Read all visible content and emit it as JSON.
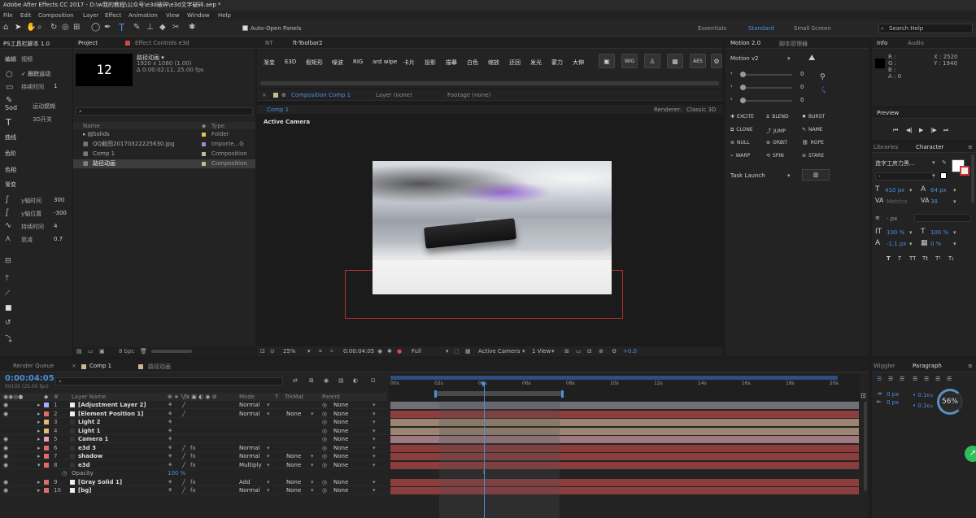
{
  "title_bar": {
    "title": "Adobe After Effects CC 2017 - D:\\w我的教程\\公众号\\e3d破碎\\e3d文字破碎.aep *"
  },
  "menu": [
    "File",
    "Edit",
    "Composition",
    "Layer",
    "Effect",
    "Animation",
    "View",
    "Window",
    "Help"
  ],
  "toolbar": {
    "auto_open_panels": "Auto-Open Panels",
    "workspaces": [
      "Essentials",
      "Standard",
      "Small Screen"
    ],
    "active_workspace": "Standard",
    "search_help": "Search Help"
  },
  "ps_panel": {
    "title": "PS工具栏脚本 1.0",
    "tabs": [
      "编辑",
      "视频"
    ],
    "auto_motion": "运动缓动",
    "auto_motion_on": "跟踪运动",
    "duration_label": "持续时间",
    "duration_value": "1",
    "motion_text": "运动模糊",
    "d3_text": "3D开关",
    "sections": [
      "曲线",
      "色阶",
      "色相",
      "渐变"
    ],
    "y_time_label": "y轴时间",
    "y_time_value": "300",
    "y_pos_label": "y轴位置",
    "y_pos_value": "-300",
    "dur_label": "持续时间",
    "dur_value": "4",
    "ease_label": "衰减",
    "ease_value": "0.7"
  },
  "project": {
    "tabs": [
      "Project",
      "Effect Controls e3d"
    ],
    "thumb_text": "12",
    "comp_name": "路径动画 ▾",
    "comp_res": "1920 x 1080 (1.00)",
    "comp_dur": "Δ 0:00:02:11, 25.00 fps",
    "cols": [
      "Name",
      "Type"
    ],
    "items": [
      {
        "name": "Solids",
        "type": "Folder",
        "color": "#d9c74a"
      },
      {
        "name": "QQ截图20170322225630.jpg",
        "type": "Importe...G",
        "color": "#9b8fd0"
      },
      {
        "name": "Comp 1",
        "type": "Composition",
        "color": "#c9b98f"
      },
      {
        "name": "路径动画",
        "type": "Composition",
        "color": "#c9b98f"
      }
    ],
    "bpc": "8 bpc"
  },
  "ft_toolbar": {
    "tabs": [
      "NT",
      "ft-Toolbar2"
    ],
    "buttons": [
      "渐变",
      "E3D",
      "假矩形",
      "噪波",
      "RIG",
      "ard wipe",
      "卡片",
      "投影",
      "描摹",
      "白色",
      "缩放",
      "还回",
      "发光",
      "蒙力",
      "大伸"
    ],
    "icon_buttons": [
      "WIG",
      "AES"
    ]
  },
  "viewer": {
    "tabs": [
      "Composition Comp 1",
      "Layer (none)",
      "Footage (none)"
    ],
    "comp_tab": "Comp 1",
    "renderer": "Renderer:",
    "renderer_value": "Classic 3D",
    "camera_label": "Active Camera",
    "zoom": "25%",
    "timecode": "0:00:04:05",
    "resolution": "Full",
    "view_cam": "Active Camera",
    "views": "1 View",
    "exposure": "+0.0"
  },
  "motion": {
    "tabs": [
      "Motion 2.0",
      "脚本管理器"
    ],
    "version": "Motion v2",
    "slider_values": [
      "0",
      "0",
      "0"
    ],
    "buttons": [
      "EXCITE",
      "BLEND",
      "BURST",
      "CLONE",
      "JUMP",
      "NAME",
      "NULL",
      "ORBIT",
      "ROPE",
      "WARP",
      "SPIN",
      "STARE"
    ],
    "task": "Task Launch"
  },
  "info": {
    "tabs": [
      "Info",
      "Audio"
    ],
    "r": "R :",
    "g": "G :",
    "b": "B :",
    "a": "A : 0",
    "x": "X : 2520",
    "y": "Y : 1940"
  },
  "preview": {
    "tab": "Preview"
  },
  "character": {
    "tabs": [
      "Libraries",
      "Character"
    ],
    "font": "造字工房力黑...",
    "font_style": "-",
    "size": "410 px",
    "leading": "64 px",
    "tracking_label": "Metrics",
    "tracking": "38",
    "stroke": "- px",
    "vscale": "100 %",
    "hscale": "100 %",
    "baseline": "-1.1 px",
    "tsume": "0 %",
    "styles": [
      "T",
      "T",
      "TT",
      "Tt",
      "T¹",
      "T₁"
    ]
  },
  "render_queue": {
    "tab": "Render Queue"
  },
  "timeline": {
    "tabs": [
      "Comp 1",
      "路径动画"
    ],
    "timecode": "0:00:04:05",
    "sub_timecode": "00105 (25.00 fps)",
    "header_cols": [
      "#",
      "Layer Name",
      "Mode",
      "T",
      "TrkMat",
      "Parent"
    ],
    "ruler": [
      "00s",
      "02s",
      "04s",
      "06s",
      "08s",
      "10s",
      "12s",
      "14s",
      "16s",
      "18s",
      "20s"
    ],
    "layers": [
      {
        "num": "1",
        "name": "[Adjustment Layer 2]",
        "mode": "Normal",
        "trk": "",
        "parent": "None",
        "color": "#a8a8ff",
        "bar": "#6f6f78"
      },
      {
        "num": "2",
        "name": "[Element Position 1]",
        "mode": "Normal",
        "trk": "None",
        "parent": "None",
        "color": "#e06b6b",
        "bar": "#8c3d3d"
      },
      {
        "num": "3",
        "name": "Light 2",
        "mode": "",
        "trk": "",
        "parent": "None",
        "color": "#e8b87a",
        "bar": "#9c8470"
      },
      {
        "num": "4",
        "name": "Light 1",
        "mode": "",
        "trk": "",
        "parent": "None",
        "color": "#e8b87a",
        "bar": "#9c8470"
      },
      {
        "num": "5",
        "name": "Camera 1",
        "mode": "",
        "trk": "",
        "parent": "None",
        "color": "#e8a0b0",
        "bar": "#9c7a80"
      },
      {
        "num": "6",
        "name": "e3d 3",
        "mode": "Normal",
        "trk": "",
        "parent": "None",
        "color": "#e06b6b",
        "bar": "#8c3d3d"
      },
      {
        "num": "7",
        "name": "shadow",
        "mode": "Normal",
        "trk": "None",
        "parent": "None",
        "color": "#e06b6b",
        "bar": "#8c3d3d"
      },
      {
        "num": "8",
        "name": "e3d",
        "mode": "Multiply",
        "trk": "None",
        "parent": "None",
        "color": "#e06b6b",
        "bar": "#8c3d3d"
      },
      {
        "num": "9",
        "name": "[Gray Solid 1]",
        "mode": "Add",
        "trk": "None",
        "parent": "None",
        "color": "#e06b6b",
        "bar": "#8c3d3d"
      },
      {
        "num": "10",
        "name": "[bg]",
        "mode": "Normal",
        "trk": "None",
        "parent": "None",
        "color": "#e06b6b",
        "bar": "#8c3d3d"
      }
    ],
    "opacity_label": "Opacity",
    "opacity_value": "100 %"
  },
  "wiggler": {
    "tabs": [
      "Wiggler",
      "Paragraph"
    ],
    "indent1": "0 px",
    "indent2": "0 px",
    "space1": "0.1",
    "space1_unit": "K/s",
    "space2": "0.1",
    "space2_unit": "K/s",
    "percent": "56%"
  }
}
